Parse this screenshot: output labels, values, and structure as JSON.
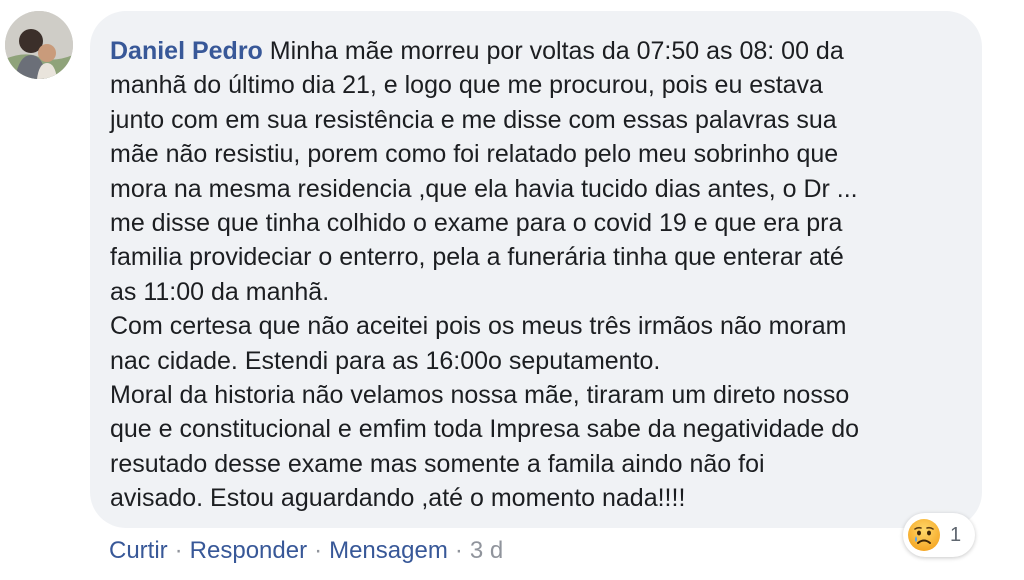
{
  "comment": {
    "author": "Daniel Pedro",
    "text_lines": [
      "Minha mãe morreu por voltas da 07:50 as 08: 00 da",
      "manhã do último dia 21, e logo que me procurou, pois eu estava",
      "junto com em sua resistência e me disse com essas palavras sua",
      "mãe não resistiu, porem como foi relatado pelo meu sobrinho que",
      "mora na mesma residencia ,que ela havia tucido dias antes, o Dr ...",
      "me disse que tinha colhido o exame para o covid 19 e que era pra",
      "familia provideciar o enterro, pela a funerária tinha que enterar até",
      "as 11:00 da manhã.",
      "Com certesa que não aceitei pois os meus três irmãos não moram",
      "nac cidade. Estendi para as 16:00o seputamento.",
      "Moral da historia não velamos nossa mãe, tiraram um direto nosso",
      "que e constitucional e emfim toda Impresa sabe da negatividade do",
      "resutado desse exame mas somente a famila aindo não foi",
      "avisado. Estou aguardando ,até o momento nada!!!!"
    ],
    "reaction": {
      "icon": "sad-face-icon",
      "count": "1"
    }
  },
  "actions": {
    "like": "Curtir",
    "reply": "Responder",
    "message": "Mensagem",
    "separator": "·",
    "time": "3 d"
  },
  "colors": {
    "author": "#385898",
    "bubble": "#f0f2f5",
    "text": "#1c1e21",
    "meta": "#90949c",
    "sad_face": "#f7b125"
  }
}
